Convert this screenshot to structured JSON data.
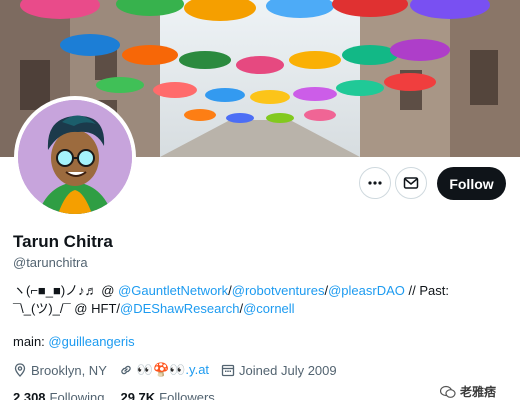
{
  "profile": {
    "display_name": "Tarun Chitra",
    "handle": "@tarunchitra"
  },
  "actions": {
    "more_icon": "more-dots-icon",
    "message_icon": "envelope-icon",
    "follow_label": "Follow"
  },
  "bio": {
    "line1_prefix": "ヽ(⌐■_■)ノ♪♬ @ ",
    "link_gauntlet": "@GauntletNetwork",
    "sep1": "/",
    "link_robot": "@robotventures",
    "sep2": "/",
    "link_pleasr": "@pleasrDAO",
    "past": " // Past:",
    "line2_prefix": "¯\\_(ツ)_/¯ @ HFT/",
    "link_deshaw": "@DEShawResearch",
    "sep3": "/",
    "link_cornell": "@cornell",
    "main_label": "main: ",
    "link_main": "@guilleangeris"
  },
  "meta": {
    "location": "Brooklyn, NY",
    "website": "👀🍄👀.y.at",
    "joined": "Joined July 2009",
    "location_icon": "location-pin-icon",
    "link_icon": "link-icon",
    "calendar_icon": "calendar-icon"
  },
  "counts": {
    "following_num": "2,308",
    "following_label": "Following",
    "followers_num": "29.7K",
    "followers_label": "Followers"
  },
  "watermark": {
    "text": "老雅痞"
  },
  "colors": {
    "accent": "#1d9bf0",
    "text": "#0f1419",
    "muted": "#536471",
    "follow_bg": "#0f1419"
  }
}
